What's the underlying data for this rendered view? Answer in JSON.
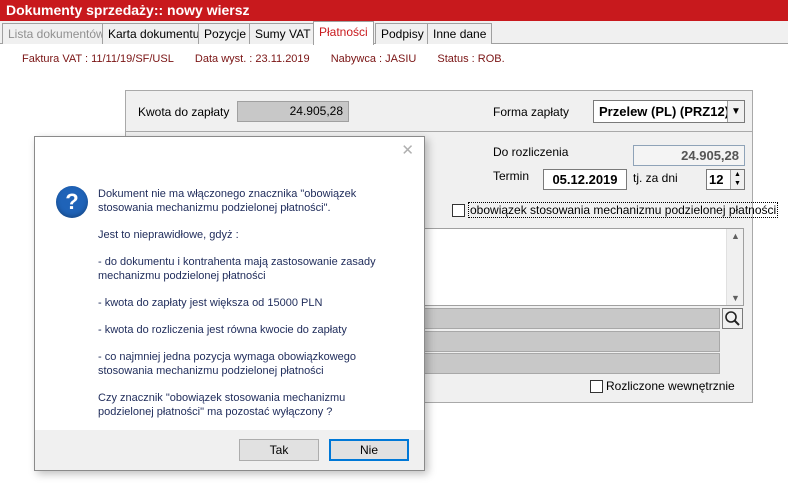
{
  "window": {
    "title": "Dokumenty sprzedaży:: nowy wiersz"
  },
  "tabs": [
    {
      "label": "Lista dokumentów"
    },
    {
      "label": "Karta dokumentu"
    },
    {
      "label": "Pozycje"
    },
    {
      "label": "Sumy VAT"
    },
    {
      "label": "Płatności"
    },
    {
      "label": "Podpisy"
    },
    {
      "label": "Inne dane"
    }
  ],
  "active_tab": "Płatności",
  "info": {
    "invoice": "Faktura VAT : 11/11/19/SF/USL",
    "date": "Data wyst. : 23.11.2019",
    "buyer": "Nabywca : JASIU",
    "status": "Status : ROB."
  },
  "form": {
    "amount_label": "Kwota do zapłaty",
    "amount_value": "24.905,28",
    "payment_form_label": "Forma zapłaty",
    "payment_form_value": "Przelew (PL)  (PRZ12)",
    "to_settle_label": "Do rozliczenia",
    "to_settle_value": "24.905,28",
    "term_label": "Termin",
    "term_value": "05.12.2019",
    "days_label": "tj. za dni",
    "days_value": "12",
    "split_payment_checkbox": "obowiązek stosowania mechanizmu podzielonej płatności",
    "split_payment_checked": false,
    "internal_settled_checkbox": "Rozliczone wewnętrznie",
    "internal_settled_checked": false
  },
  "dialog": {
    "close_glyph": "✕",
    "icon": "question-icon",
    "icon_glyph": "?",
    "paragraphs": [
      "Dokument nie ma włączonego znacznika \"obowiązek\nstosowania mechanizmu podzielonej płatności\".",
      "Jest to nieprawidłowe, gdyż :",
      "- do dokumentu i kontrahenta mają zastosowanie zasady\nmechanizmu podzielonej płatności",
      "- kwota do zapłaty jest większa od 15000 PLN",
      "- kwota do rozliczenia jest równa kwocie do zapłaty",
      "- co najmniej jedna pozycja wymaga obowiązkowego\nstosowania mechanizmu podzielonej płatności",
      "Czy znacznik \"obowiązek stosowania mechanizmu\npodzielonej płatności\" ma pozostać wyłączony ?"
    ],
    "buttons": {
      "yes": "Tak",
      "no": "Nie"
    }
  },
  "colors": {
    "titlebar": "#c8191d",
    "active_tab_text": "#c8191d",
    "info_text": "#7a1414",
    "dialog_text": "#1e2b5a",
    "default_button_border": "#0078d7"
  }
}
